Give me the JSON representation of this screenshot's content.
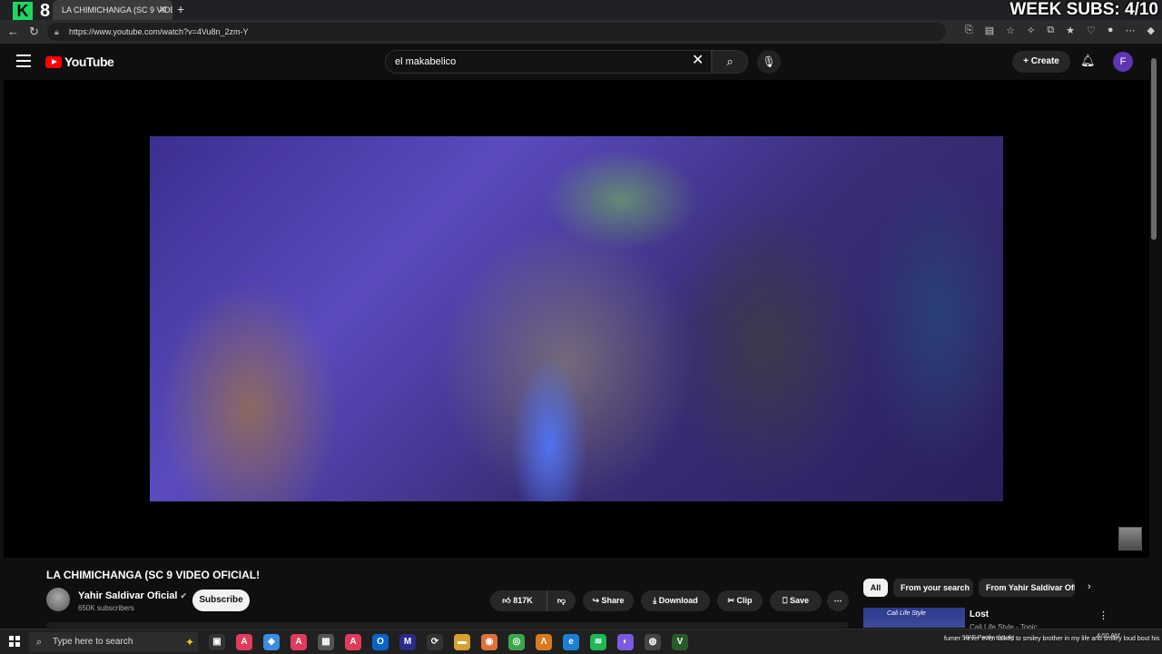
{
  "overlay": {
    "brand_letter": "K",
    "brand_number": "8",
    "subs_text": "WEEK SUBS: 4/10"
  },
  "browser": {
    "tab_title": "LA CHIMICHANGA (SC 9 VIDEO",
    "url": "https://www.youtube.com/watch?v=4Vu8n_2zm-Y"
  },
  "youtube": {
    "logo_text": "YouTube",
    "search_value": "el makabelico",
    "create_label": "Create",
    "avatar_letter": "F"
  },
  "video": {
    "title": "LA CHIMICHANGA (SC 9 VIDEO OFICIAL!",
    "channel_name": "Yahir Saldivar Oficial",
    "subscribers": "650K subscribers",
    "subscribe_label": "Subscribe",
    "likes": "817K",
    "share_label": "Share",
    "download_label": "Download",
    "clip_label": "Clip",
    "save_label": "Save"
  },
  "sidebar": {
    "chips": [
      "All",
      "From your search",
      "From Yahir Saldivar Oficial"
    ],
    "rec_thumb_text": "Cali Life Style",
    "rec_title": "Lost",
    "rec_sub": "Cali Life Style - Topic"
  },
  "taskbar": {
    "search_placeholder": "Type here to search",
    "chat_text": "fumer: never even talked to smiley brother in my life and smiley loud bout his age too said he was 16 but really 17 ☺☺☺☺☺ get it off dick bitch",
    "weather": "58°F Partly cloudy",
    "clock": "4:50 AM"
  }
}
